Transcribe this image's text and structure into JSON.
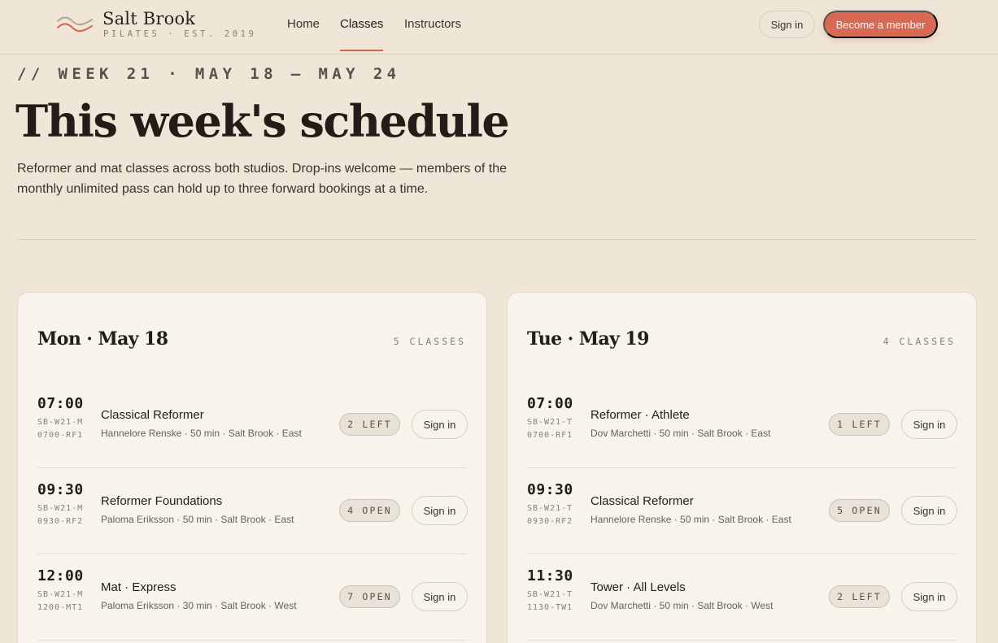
{
  "brand": {
    "name": "Salt Brook",
    "tagline": "PILATES · EST. 2019",
    "accent": "#d86a55"
  },
  "nav": {
    "items": [
      {
        "label": "Home"
      },
      {
        "label": "Classes",
        "active": true
      },
      {
        "label": "Instructors"
      }
    ],
    "signin_label": "Sign in",
    "member_label": "Become a member"
  },
  "hero": {
    "eyebrow": "// WEEK 21 · MAY 18 – MAY 24",
    "title": "This week's schedule",
    "intro": "Reformer and mat classes across both studios. Drop-ins welcome — members of the monthly unlimited pass can hold up to three forward bookings at a time."
  },
  "days": [
    {
      "title": "Mon · May 18",
      "count": "5 CLASSES",
      "sessions": [
        {
          "time": "07:00",
          "code": "SB-W21-M0700-RF1",
          "name": "Classical Reformer",
          "meta": "Hannelore Renske · 50 min · Salt Brook · East",
          "availability": "2 LEFT",
          "action": "Sign in"
        },
        {
          "time": "09:30",
          "code": "SB-W21-M0930-RF2",
          "name": "Reformer Foundations",
          "meta": "Paloma Eriksson · 50 min · Salt Brook · East",
          "availability": "4 OPEN",
          "action": "Sign in"
        },
        {
          "time": "12:00",
          "code": "SB-W21-M1200-MT1",
          "name": "Mat · Express",
          "meta": "Paloma Eriksson · 30 min · Salt Brook · West",
          "availability": "7 OPEN",
          "action": "Sign in"
        }
      ]
    },
    {
      "title": "Tue · May 19",
      "count": "4 CLASSES",
      "sessions": [
        {
          "time": "07:00",
          "code": "SB-W21-T0700-RF1",
          "name": "Reformer · Athlete",
          "meta": "Dov Marchetti · 50 min · Salt Brook · East",
          "availability": "1 LEFT",
          "action": "Sign in"
        },
        {
          "time": "09:30",
          "code": "SB-W21-T0930-RF2",
          "name": "Classical Reformer",
          "meta": "Hannelore Renske · 50 min · Salt Brook · East",
          "availability": "5 OPEN",
          "action": "Sign in"
        },
        {
          "time": "11:30",
          "code": "SB-W21-T1130-TW1",
          "name": "Tower · All Levels",
          "meta": "Dov Marchetti · 50 min · Salt Brook · West",
          "availability": "2 LEFT",
          "action": "Sign in"
        }
      ]
    }
  ]
}
